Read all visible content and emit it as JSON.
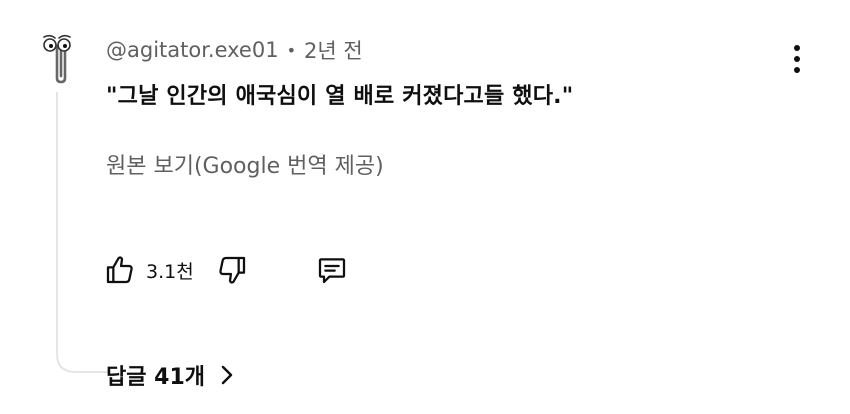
{
  "comment": {
    "author": "@agitator.exe01",
    "separator": "•",
    "time": "2년 전",
    "text": "\"그날 인간의 애국심이 열 배로 커졌다고들 했다.\"",
    "translate_link": "원본 보기(Google 번역 제공)",
    "like_count": "3.1천",
    "replies_label": "답글 41개"
  },
  "icons": {
    "avatar": "clippy-paperclip-icon",
    "menu": "more-vertical-icon",
    "like": "thumbs-up-icon",
    "dislike": "thumbs-down-icon",
    "reply": "comment-icon",
    "expand": "chevron-right-icon"
  },
  "colors": {
    "text": "#0f0f0f",
    "secondary": "#606060",
    "thread_line": "#e5e5e5"
  }
}
